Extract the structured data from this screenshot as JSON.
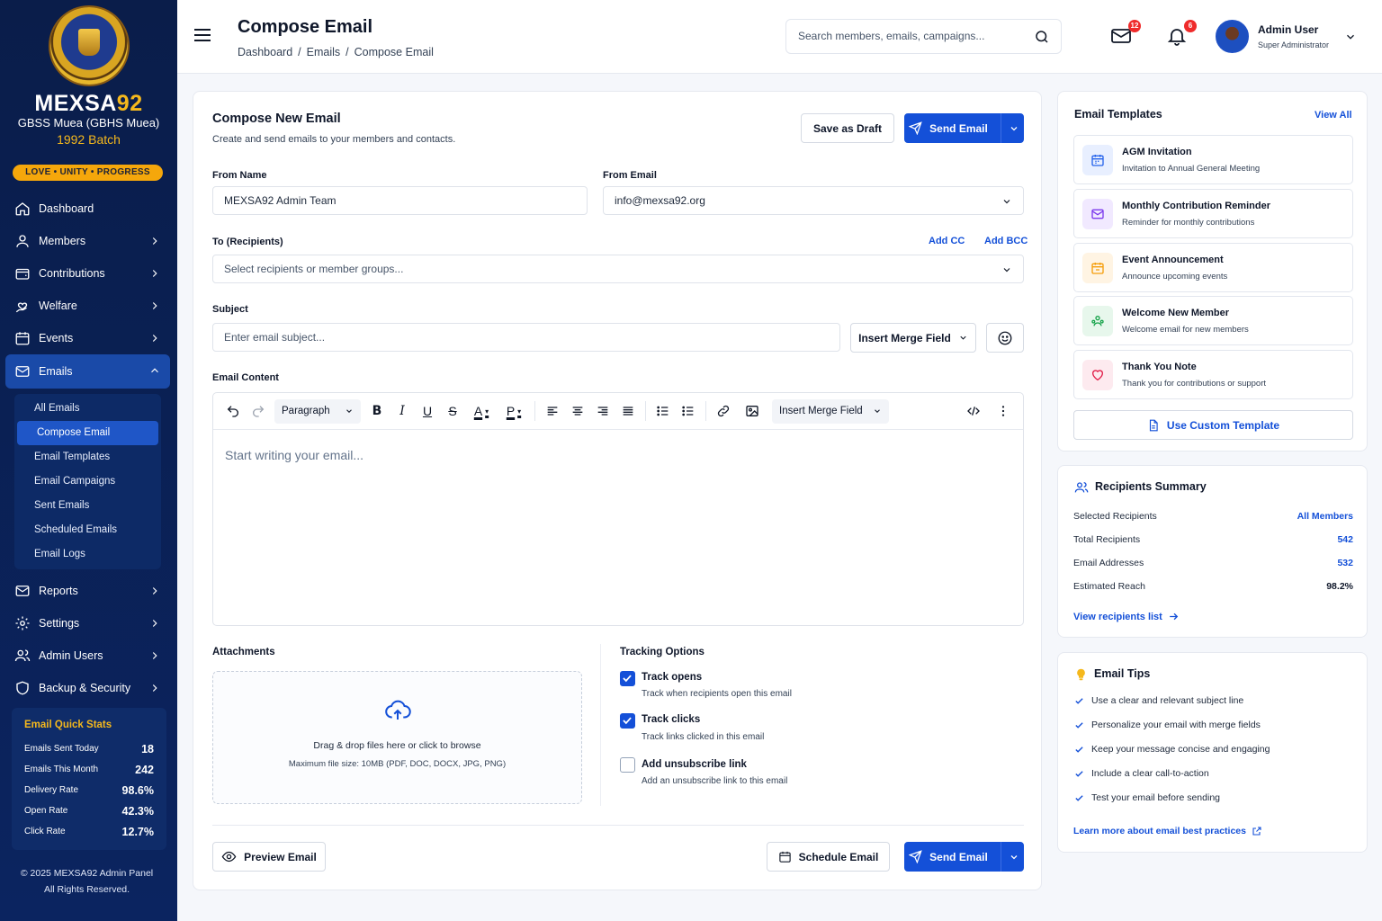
{
  "brand": {
    "name_main": "MEXSA",
    "name_accent": "92",
    "school": "GBSS Muea (GBHS Muea)",
    "batch": "1992 Batch",
    "motto": "LOVE • UNITY • PROGRESS"
  },
  "nav": {
    "items": [
      {
        "label": "Dashboard"
      },
      {
        "label": "Members"
      },
      {
        "label": "Contributions"
      },
      {
        "label": "Welfare"
      },
      {
        "label": "Events"
      },
      {
        "label": "Emails"
      }
    ],
    "emails_sub": [
      "All Emails",
      "Compose Email",
      "Email Templates",
      "Email Campaigns",
      "Sent Emails",
      "Scheduled Emails",
      "Email Logs"
    ],
    "items_after": [
      {
        "label": "Reports"
      },
      {
        "label": "Settings"
      },
      {
        "label": "Admin Users"
      },
      {
        "label": "Backup & Security"
      }
    ]
  },
  "quick_stats": {
    "title": "Email Quick Stats",
    "rows": [
      {
        "label": "Emails Sent Today",
        "value": "18"
      },
      {
        "label": "Emails This Month",
        "value": "242"
      },
      {
        "label": "Delivery Rate",
        "value": "98.6%"
      },
      {
        "label": "Open Rate",
        "value": "42.3%"
      },
      {
        "label": "Click Rate",
        "value": "12.7%"
      }
    ]
  },
  "footer": {
    "line1": "© 2025 MEXSA92 Admin Panel",
    "line2": "All Rights Reserved."
  },
  "header": {
    "title": "Compose Email",
    "crumbs": [
      "Dashboard",
      "/",
      "Emails",
      "/",
      "Compose Email"
    ],
    "search_placeholder": "Search members, emails, campaigns...",
    "mail_badge": "12",
    "notif_badge": "6",
    "user_name": "Admin User",
    "user_role": "Super Administrator"
  },
  "compose": {
    "title": "Compose New Email",
    "subtitle": "Create and send emails to your members and contacts.",
    "save_draft": "Save as Draft",
    "send": "Send Email",
    "from_name_label": "From Name",
    "from_name_value": "MEXSA92 Admin Team",
    "from_email_label": "From Email",
    "from_email_value": "info@mexsa92.org",
    "to_label": "To (Recipients)",
    "add_cc": "Add CC",
    "add_bcc": "Add BCC",
    "to_placeholder": "Select recipients or member groups...",
    "subject_label": "Subject",
    "subject_placeholder": "Enter email subject...",
    "insert_merge": "Insert Merge Field",
    "content_label": "Email Content",
    "paragraph": "Paragraph",
    "editor_placeholder": "Start writing your email...",
    "attachments_label": "Attachments",
    "drop_text": "Drag & drop files here or click to browse",
    "drop_hint": "Maximum file size: 10MB (PDF, DOC, DOCX, JPG, PNG)",
    "tracking_label": "Tracking Options",
    "tracking": [
      {
        "title": "Track opens",
        "desc": "Track when recipients open this email",
        "checked": true
      },
      {
        "title": "Track clicks",
        "desc": "Track links clicked in this email",
        "checked": true
      },
      {
        "title": "Add unsubscribe link",
        "desc": "Add an unsubscribe link to this email",
        "checked": false
      }
    ],
    "preview": "Preview Email",
    "schedule": "Schedule Email"
  },
  "templates": {
    "title": "Email Templates",
    "view_all": "View All",
    "items": [
      {
        "title": "AGM Invitation",
        "desc": "Invitation to Annual General Meeting",
        "icon": "calendar-icon",
        "color": "#2563eb",
        "bg": "#e8efff"
      },
      {
        "title": "Monthly Contribution Reminder",
        "desc": "Reminder for monthly contributions",
        "icon": "mail-icon",
        "color": "#7c3aed",
        "bg": "#f1e9ff"
      },
      {
        "title": "Event Announcement",
        "desc": "Announce upcoming events",
        "icon": "calendar-icon",
        "color": "#f59e0b",
        "bg": "#fff4e3"
      },
      {
        "title": "Welcome New Member",
        "desc": "Welcome email for new members",
        "icon": "users-icon",
        "color": "#16a34a",
        "bg": "#e7f7ec"
      },
      {
        "title": "Thank You Note",
        "desc": "Thank you for contributions or support",
        "icon": "heart-icon",
        "color": "#e11d48",
        "bg": "#fdeaef"
      }
    ],
    "custom": "Use Custom Template"
  },
  "recipients": {
    "title": "Recipients Summary",
    "rows": [
      {
        "label": "Selected Recipients",
        "value": "All Members"
      },
      {
        "label": "Total Recipients",
        "value": "542"
      },
      {
        "label": "Email Addresses",
        "value": "532"
      },
      {
        "label": "Estimated Reach",
        "value": "98.2%"
      }
    ],
    "view_list": "View recipients list"
  },
  "tips": {
    "title": "Email Tips",
    "items": [
      "Use a clear and relevant subject line",
      "Personalize your email with merge fields",
      "Keep your message concise and engaging",
      "Include a clear call-to-action",
      "Test your email before sending"
    ],
    "learn_more": "Learn more about email best practices"
  },
  "colors": {
    "primary": "#1450d8",
    "sidebar": "#0a1d4a",
    "accent": "#f5b81c"
  }
}
